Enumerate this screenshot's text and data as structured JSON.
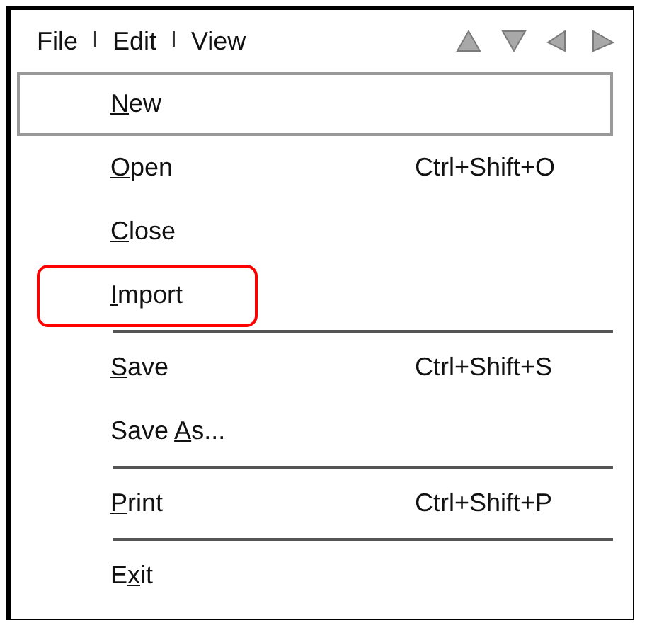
{
  "menu_bar": [
    {
      "kind": "menu",
      "label": "File"
    },
    {
      "kind": "divider",
      "label": "I"
    },
    {
      "kind": "menu",
      "label": "Edit"
    },
    {
      "kind": "divider",
      "label": "I"
    },
    {
      "kind": "menu",
      "label": "View"
    }
  ],
  "menu": [
    {
      "kind": "item",
      "key": "N",
      "after": "ew",
      "selected": true,
      "highlighted": false
    },
    {
      "kind": "item",
      "key": "O",
      "after": "pen",
      "shortcut": "Ctrl+Shift+O",
      "selected": false,
      "highlighted": false
    },
    {
      "kind": "item",
      "key": "C",
      "after": "lose",
      "selected": false,
      "highlighted": false
    },
    {
      "kind": "item",
      "key": "I",
      "after": "mport",
      "selected": false,
      "highlighted": true
    },
    {
      "kind": "separator"
    },
    {
      "kind": "item",
      "key": "S",
      "after": "ave",
      "shortcut": "Ctrl+Shift+S",
      "selected": false,
      "highlighted": false
    },
    {
      "kind": "item",
      "before": "Save ",
      "key": "A",
      "after": "s...",
      "selected": false,
      "highlighted": false
    },
    {
      "kind": "separator"
    },
    {
      "kind": "item",
      "key": "P",
      "after": "rint",
      "shortcut": "Ctrl+Shift+P",
      "selected": false,
      "highlighted": false
    },
    {
      "kind": "separator"
    },
    {
      "kind": "item",
      "before": "E",
      "key": "x",
      "after": "it",
      "selected": false,
      "highlighted": false
    }
  ]
}
